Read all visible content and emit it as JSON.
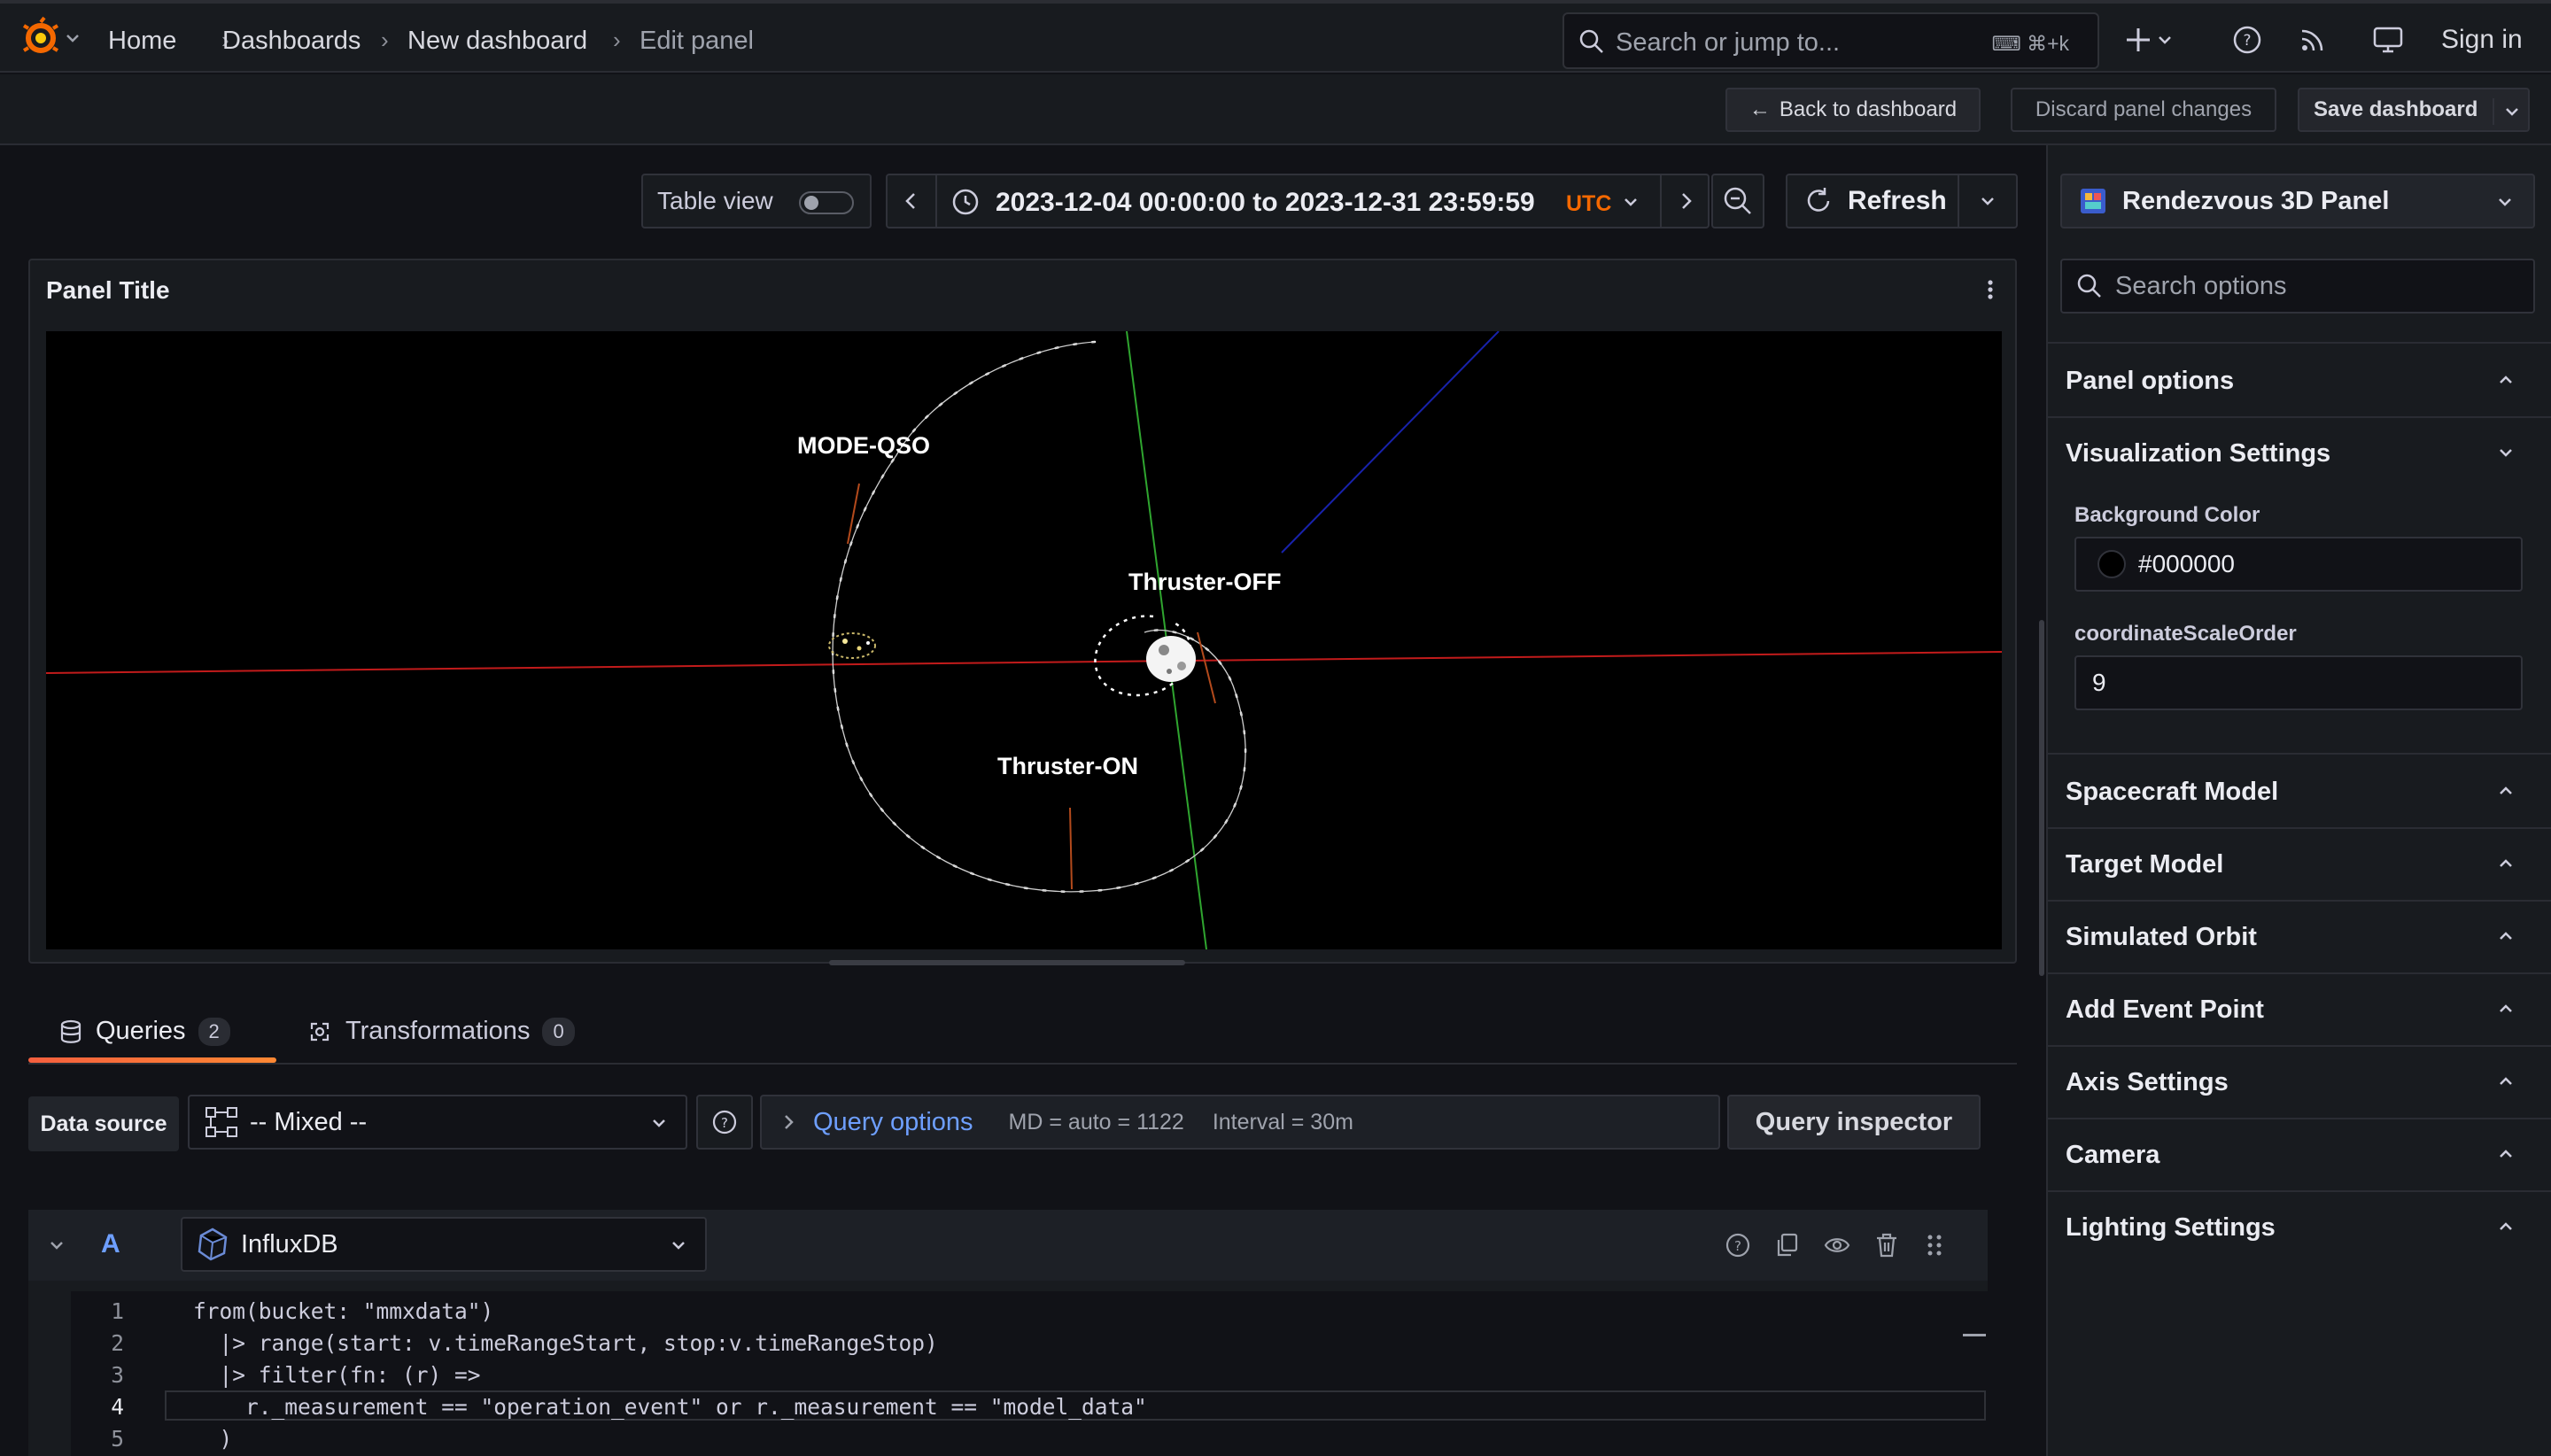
{
  "nav": {
    "breadcrumbs": [
      "Home",
      "Dashboards",
      "New dashboard",
      "Edit panel"
    ],
    "search_placeholder": "Search or jump to...",
    "search_shortcut": "⌘+k",
    "sign_in": "Sign in"
  },
  "toolbar": {
    "back": "Back to dashboard",
    "discard": "Discard panel changes",
    "save": "Save dashboard"
  },
  "controls": {
    "table_view": "Table view",
    "time_range": "2023-12-04 00:00:00 to 2023-12-31 23:59:59",
    "timezone": "UTC",
    "refresh": "Refresh"
  },
  "panel": {
    "title": "Panel Title",
    "labels": {
      "mode": "MODE-QSO",
      "thruster_off": "Thruster-OFF",
      "thruster_on": "Thruster-ON"
    }
  },
  "tabs": [
    {
      "label": "Queries",
      "count": "2"
    },
    {
      "label": "Transformations",
      "count": "0"
    }
  ],
  "query_row": {
    "data_source_label": "Data source",
    "data_source_value": "-- Mixed --",
    "query_options": "Query options",
    "md": "MD = auto = 1122",
    "interval": "Interval = 30m",
    "inspector": "Query inspector"
  },
  "query_a": {
    "ref": "A",
    "datasource": "InfluxDB",
    "lines": [
      {
        "n": "1",
        "text": "from(bucket: \"mmxdata\")"
      },
      {
        "n": "2",
        "text": "  |> range(start: v.timeRangeStart, stop:v.timeRangeStop)"
      },
      {
        "n": "3",
        "text": "  |> filter(fn: (r) =>"
      },
      {
        "n": "4",
        "text": "    r._measurement == \"operation_event\" or r._measurement == \"model_data\""
      },
      {
        "n": "5",
        "text": "  )"
      }
    ]
  },
  "sidebar": {
    "visualization": "Rendezvous 3D Panel",
    "search_placeholder": "Search options",
    "sections": [
      "Panel options",
      "Visualization Settings",
      "Spacecraft Model",
      "Target Model",
      "Simulated Orbit",
      "Add Event Point",
      "Axis Settings",
      "Camera",
      "Lighting Settings"
    ],
    "background_color_label": "Background Color",
    "background_color_value": "#000000",
    "coord_label": "coordinateScaleOrder",
    "coord_value": "9"
  },
  "colors": {
    "accent_orange": "#f46800",
    "link_blue": "#6e9fff",
    "bg": "#111217",
    "panel_bg": "#181b1f"
  }
}
